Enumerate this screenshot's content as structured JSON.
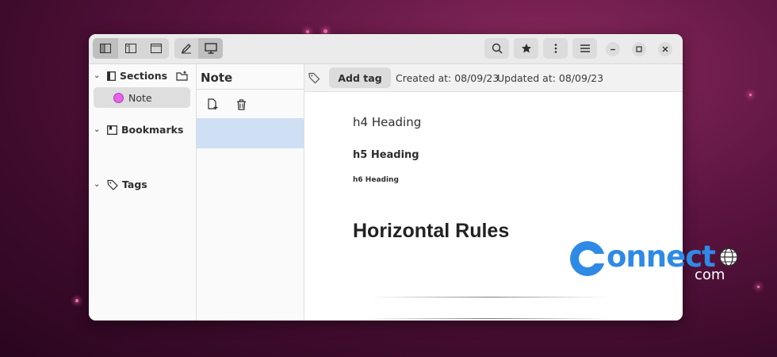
{
  "toolbar": {
    "view_buttons": [
      "sidebar-full-view",
      "sidebar-split-view",
      "editor-only-view"
    ],
    "mode_buttons": [
      "edit-mode",
      "preview-mode"
    ],
    "actions": [
      "search",
      "favorite",
      "more",
      "menu"
    ],
    "window_controls": [
      "minimize",
      "maximize",
      "close"
    ]
  },
  "sidebar": {
    "sections_label": "Sections",
    "note_label": "Note",
    "bookmarks_label": "Bookmarks",
    "tags_label": "Tags"
  },
  "notelist": {
    "title": "Note"
  },
  "editor": {
    "add_tag_label": "Add tag",
    "created": "Created at: 08/09/23",
    "updated": "Updated at: 08/09/23",
    "h4": "h4 Heading",
    "h5": "h5 Heading",
    "h6": "h6 Heading",
    "h2": "Horizontal Rules"
  },
  "watermark": {
    "brand": "onnect",
    "suffix": "com"
  },
  "colors": {
    "note_dot": "#e463e8",
    "selection": "#cfe0f5",
    "watermark_blue": "#2f8ae6"
  }
}
